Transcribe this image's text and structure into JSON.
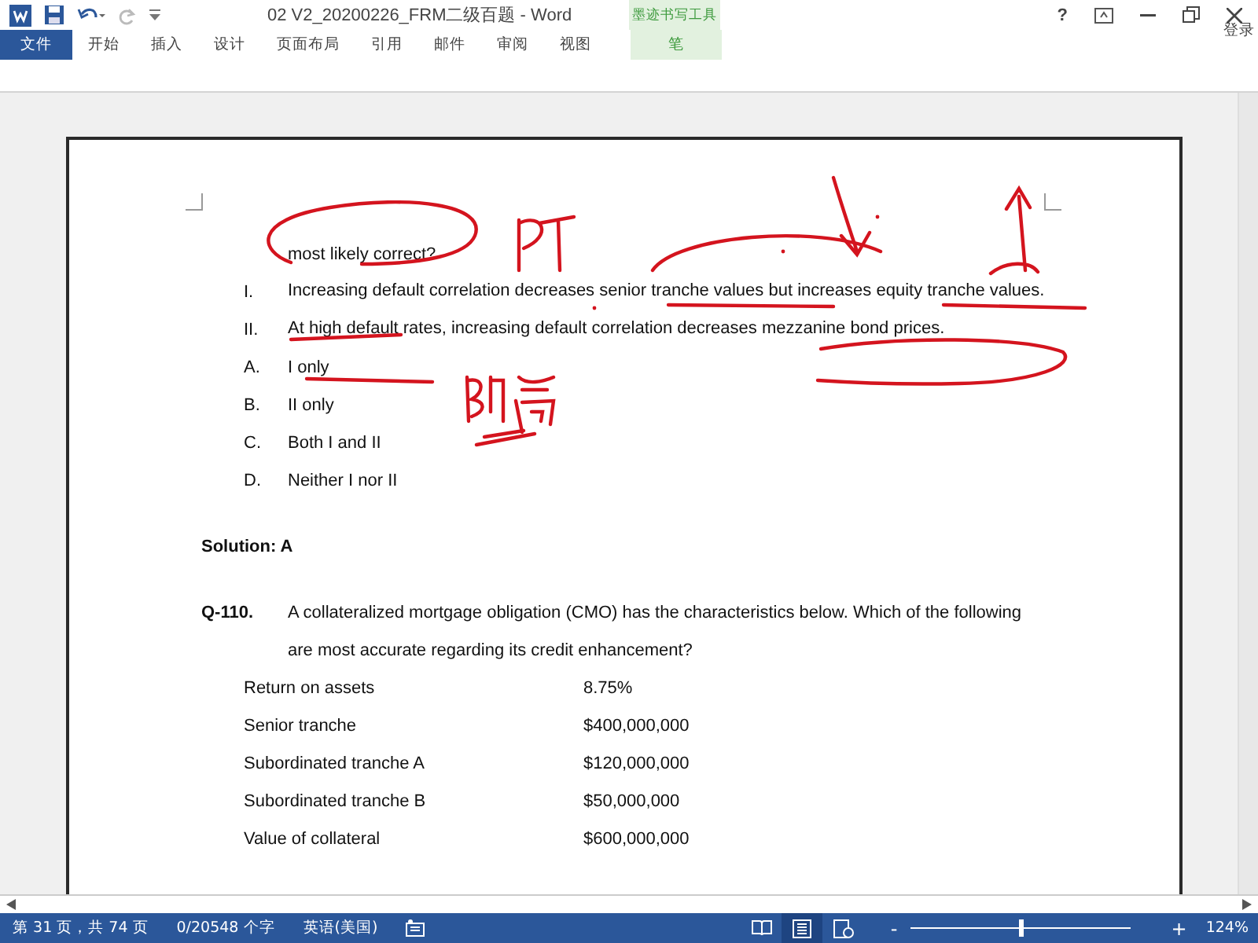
{
  "window": {
    "title": "02 V2_20200226_FRM二级百题 - Word",
    "help": "?"
  },
  "ribbon": {
    "file_tab": "文件",
    "tabs": [
      {
        "label": "开始",
        "selected": false
      },
      {
        "label": "插入",
        "selected": false
      },
      {
        "label": "设计",
        "selected": false
      },
      {
        "label": "页面布局",
        "selected": false
      },
      {
        "label": "引用",
        "selected": false
      },
      {
        "label": "邮件",
        "selected": false
      },
      {
        "label": "审阅",
        "selected": false
      },
      {
        "label": "视图",
        "selected": false
      }
    ],
    "context_group": {
      "title": "墨迹书写工具",
      "tabs": [
        {
          "label": "笔",
          "selected": false
        }
      ]
    },
    "sign_in": "登录"
  },
  "document": {
    "question_tail": "most likely correct?",
    "statements": [
      {
        "marker": "I.",
        "text": "Increasing default correlation decreases senior tranche values but increases equity tranche values."
      },
      {
        "marker": "II.",
        "text": "At high default rates, increasing default correlation decreases mezzanine bond prices."
      }
    ],
    "options": [
      {
        "marker": "A.",
        "text": "I only"
      },
      {
        "marker": "B.",
        "text": "II only"
      },
      {
        "marker": "C.",
        "text": "Both I and II"
      },
      {
        "marker": "D.",
        "text": "Neither I nor II"
      }
    ],
    "solution": "Solution: A",
    "question": {
      "number": "Q-110.",
      "text": "A collateralized mortgage obligation (CMO) has the characteristics below. Which of the following are most accurate regarding its credit enhancement?"
    },
    "table": [
      {
        "label": "Return on assets",
        "value": "8.75%"
      },
      {
        "label": "Senior tranche",
        "value": "$400,000,000"
      },
      {
        "label": "Subordinated tranche A",
        "value": "$120,000,000"
      },
      {
        "label": "Subordinated tranche B",
        "value": "$50,000,000"
      },
      {
        "label": "Value of collateral",
        "value": "$600,000,000"
      }
    ]
  },
  "status_bar": {
    "page": "第 31 页，共 74 页",
    "words": "0/20548 个字",
    "language": "英语(美国)",
    "views": [
      {
        "kind": "read",
        "selected": false
      },
      {
        "kind": "print",
        "selected": true
      },
      {
        "kind": "web",
        "selected": false
      }
    ],
    "zoom_out": "-",
    "zoom_in": "+",
    "zoom_slider": {
      "level": 0.5
    },
    "zoom": "124%"
  }
}
